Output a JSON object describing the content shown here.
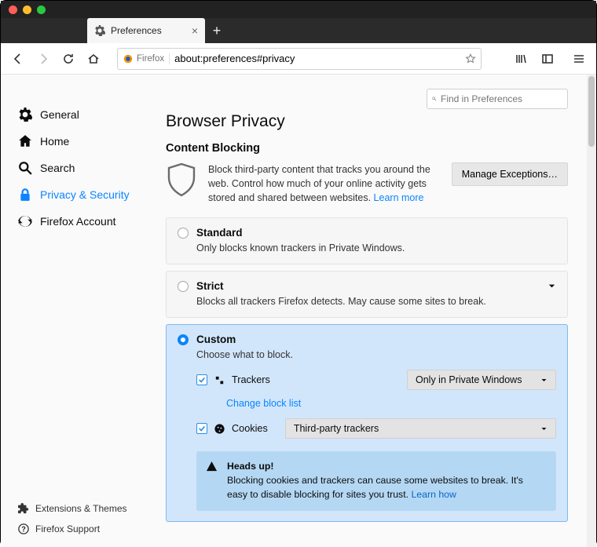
{
  "tab": {
    "title": "Preferences"
  },
  "url": {
    "brand": "Firefox",
    "value": "about:preferences#privacy"
  },
  "find": {
    "placeholder": "Find in Preferences"
  },
  "sidebar": {
    "general": "General",
    "home": "Home",
    "search": "Search",
    "privacy": "Privacy & Security",
    "account": "Firefox Account",
    "ext": "Extensions & Themes",
    "support": "Firefox Support"
  },
  "page": {
    "heading": "Browser Privacy",
    "subheading": "Content Blocking",
    "desc": "Block third-party content that tracks you around the web. Control how much of your online activity gets stored and shared between websites.  ",
    "learn_more": "Learn more",
    "manage_exceptions": "Manage Exceptions…"
  },
  "options": {
    "standard": {
      "title": "Standard",
      "body": "Only blocks known trackers in Private Windows."
    },
    "strict": {
      "title": "Strict",
      "body": "Blocks all trackers Firefox detects. May cause some sites to break."
    },
    "custom": {
      "title": "Custom",
      "body": "Choose what to block.",
      "trackers_label": "Trackers",
      "trackers_select": "Only in Private Windows",
      "change_list": "Change block list",
      "cookies_label": "Cookies",
      "cookies_select": "Third-party trackers"
    },
    "notice": {
      "title": "Heads up!",
      "body": "Blocking cookies and trackers can cause some websites to break. It's easy to disable blocking for sites you trust.  ",
      "learn_how": "Learn how"
    }
  }
}
